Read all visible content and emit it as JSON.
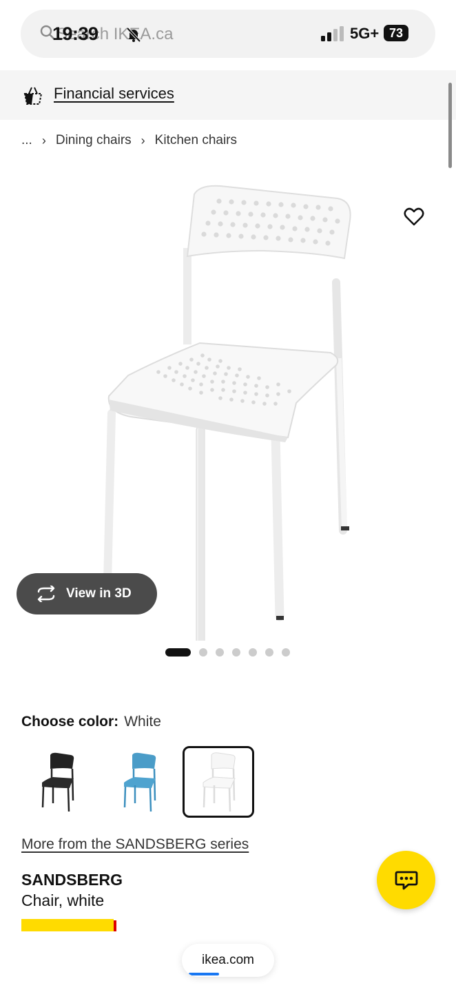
{
  "status_bar": {
    "time": "19:39",
    "network": "5G+",
    "battery": "73"
  },
  "search": {
    "text": "Search IKEA.ca"
  },
  "financial": {
    "label": "Financial services"
  },
  "breadcrumb": {
    "items": [
      "...",
      "Dining chairs",
      "Kitchen chairs"
    ]
  },
  "gallery": {
    "view3d_label": "View in 3D",
    "dot_count": 7,
    "active_index": 0
  },
  "colors": {
    "label": "Choose color:",
    "selected": "White",
    "options": [
      "Black",
      "Blue",
      "White"
    ]
  },
  "series_link": "More from the SANDSBERG series",
  "product": {
    "name": "SANDSBERG",
    "description": "Chair, white"
  },
  "url_bar": {
    "domain": "ikea.com"
  },
  "theme": {
    "accent_yellow": "#ffdb00",
    "pill_dark": "#4b4b4b",
    "progress_blue": "#1877f2"
  }
}
